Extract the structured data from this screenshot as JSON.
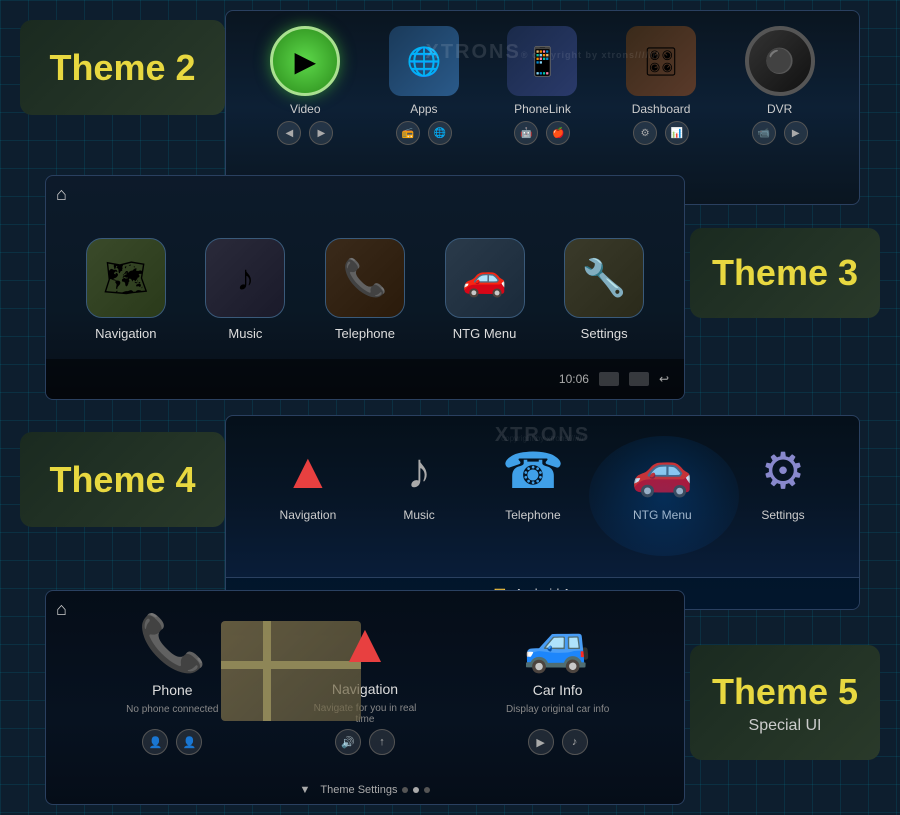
{
  "brand": "XTRONS",
  "copyright": "copyright by xtrons///////",
  "themes": {
    "theme2": {
      "label": "Theme",
      "number": "2",
      "screen": {
        "items": [
          {
            "name": "Video",
            "icon": "▶"
          },
          {
            "name": "Apps",
            "icon": "🌐"
          },
          {
            "name": "PhoneLink",
            "icon": "📱"
          },
          {
            "name": "Dashboard",
            "icon": "🎛"
          },
          {
            "name": "DVR",
            "icon": "📷"
          }
        ]
      }
    },
    "theme3": {
      "label": "Theme",
      "number": "3",
      "screen": {
        "items": [
          {
            "name": "Navigation",
            "icon": "🗺"
          },
          {
            "name": "Music",
            "icon": "♪"
          },
          {
            "name": "Telephone",
            "icon": "📞"
          },
          {
            "name": "NTG Menu",
            "icon": "🚗"
          },
          {
            "name": "Settings",
            "icon": "🔧"
          }
        ]
      }
    },
    "theme4": {
      "label": "Theme",
      "number": "4",
      "screen": {
        "items": [
          {
            "name": "Navigation",
            "icon": "nav"
          },
          {
            "name": "Music",
            "icon": "music"
          },
          {
            "name": "Telephone",
            "icon": "tel"
          },
          {
            "name": "NTG Menu",
            "icon": "ntg"
          },
          {
            "name": "Settings",
            "icon": "set"
          }
        ],
        "bottom_label": "Android Apps"
      }
    },
    "theme5": {
      "label": "Theme",
      "number": "5",
      "sublabel": "Special UI",
      "screen": {
        "items": [
          {
            "name": "Phone",
            "sublabel": "No phone connected"
          },
          {
            "name": "Navigation",
            "sublabel": "Navigate for you in real time"
          },
          {
            "name": "Car Info",
            "sublabel": "Display original car info"
          }
        ],
        "bottom_label": "Theme Settings"
      }
    }
  },
  "status": {
    "time": "10:06"
  }
}
